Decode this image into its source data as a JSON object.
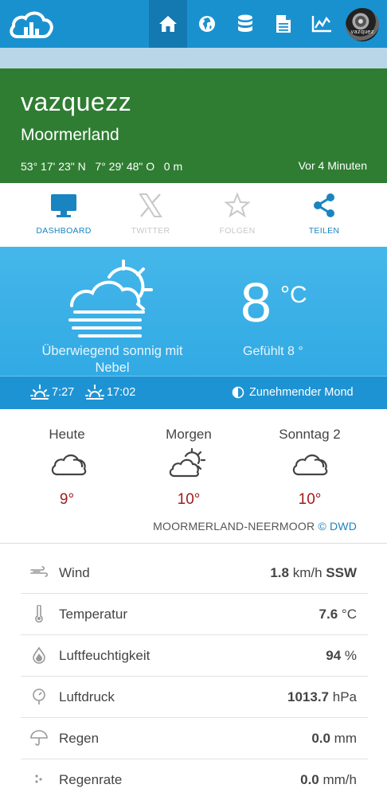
{
  "nav": {
    "items": [
      {
        "name": "home-icon",
        "active": true
      },
      {
        "name": "globe-icon",
        "active": false
      },
      {
        "name": "database-icon",
        "active": false
      },
      {
        "name": "document-icon",
        "active": false
      },
      {
        "name": "chart-icon",
        "active": false
      }
    ],
    "avatar_text": "vazquez"
  },
  "header": {
    "station_name": "vazquezz",
    "location": "Moormerland",
    "coordinates": "53° 17' 23\" N   7° 29' 48\" O   0 m",
    "updated": "Vor 4 Minuten"
  },
  "actions": [
    {
      "label": "DASHBOARD",
      "icon": "monitor-icon",
      "enabled": true
    },
    {
      "label": "TWITTER",
      "icon": "x-twitter-icon",
      "enabled": false
    },
    {
      "label": "FOLGEN",
      "icon": "star-icon",
      "enabled": false
    },
    {
      "label": "TEILEN",
      "icon": "share-icon",
      "enabled": true
    }
  ],
  "current": {
    "condition": "Überwiegend sonnig mit Nebel",
    "condition_icon": "sun-fog-cloud-icon",
    "temperature": "8",
    "unit": "°C",
    "feels_like": "Gefühlt 8 °",
    "sunrise": "7:27",
    "sunset": "17:02",
    "moon_phase": "Zunehmender Mond"
  },
  "forecast": {
    "days": [
      {
        "day": "Heute",
        "temp": "9°",
        "icon": "cloud-icon"
      },
      {
        "day": "Morgen",
        "temp": "10°",
        "icon": "sun-cloud-icon"
      },
      {
        "day": "Sonntag 2",
        "temp": "10°",
        "icon": "cloud-icon"
      }
    ],
    "source_station": "MOORMERLAND-NEERMOOR",
    "source_credit": "© DWD"
  },
  "measurements": [
    {
      "label": "Wind",
      "icon": "wind-icon",
      "value": "1.8",
      "unit": " km/h ",
      "extra": "SSW"
    },
    {
      "label": "Temperatur",
      "icon": "thermometer-icon",
      "value": "7.6",
      "unit": " °C",
      "extra": ""
    },
    {
      "label": "Luftfeuchtigkeit",
      "icon": "humidity-icon",
      "value": "94",
      "unit": " %",
      "extra": ""
    },
    {
      "label": "Luftdruck",
      "icon": "pressure-icon",
      "value": "1013.7",
      "unit": " hPa",
      "extra": ""
    },
    {
      "label": "Regen",
      "icon": "umbrella-icon",
      "value": "0.0",
      "unit": " mm",
      "extra": ""
    },
    {
      "label": "Regenrate",
      "icon": "rain-drops-icon",
      "value": "0.0",
      "unit": " mm/h",
      "extra": ""
    }
  ],
  "colors": {
    "nav_bg": "#1a91cf",
    "grass": "#2f7d32",
    "current_bg": "#2ca6e2",
    "forecast_temp": "#a31b1b",
    "accent": "#1a84c1"
  }
}
